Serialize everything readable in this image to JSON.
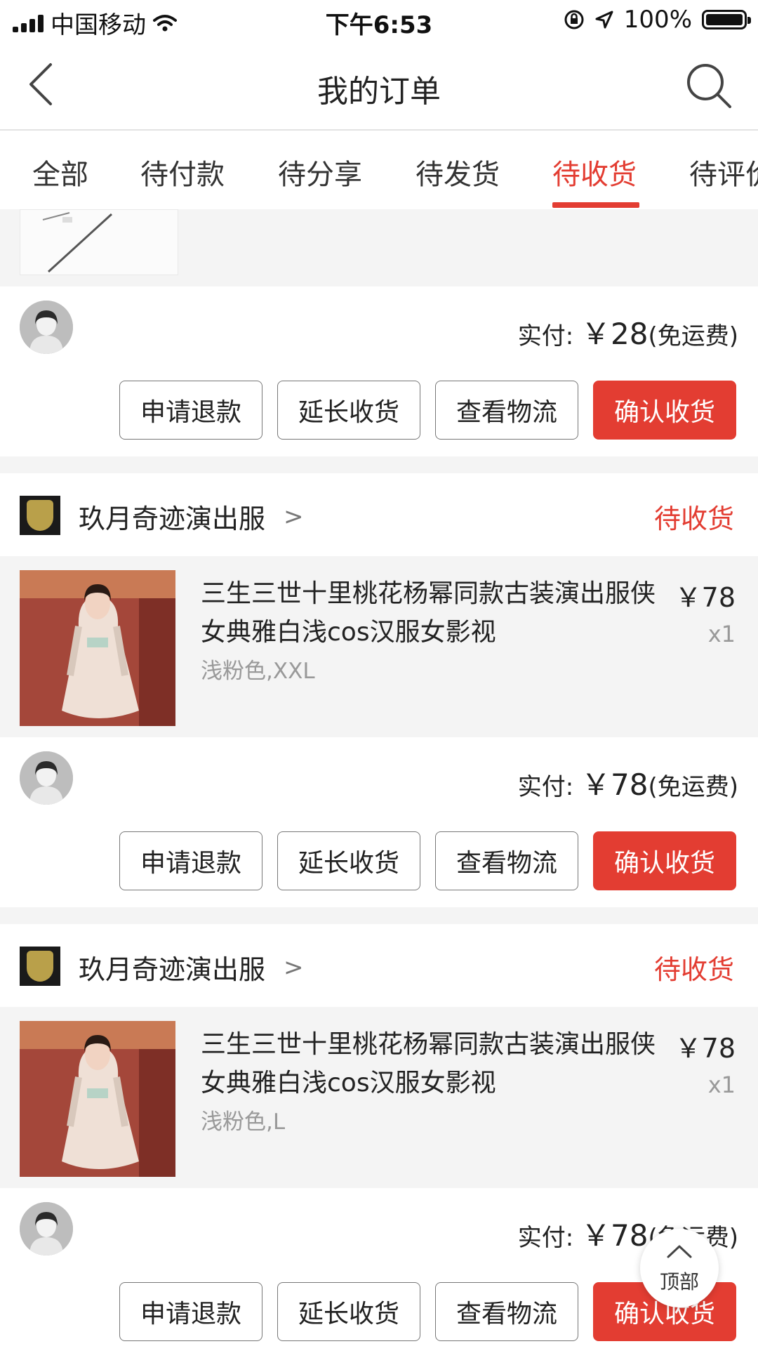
{
  "status_bar": {
    "carrier": "中国移动",
    "time": "下午6:53",
    "battery": "100%"
  },
  "nav": {
    "title": "我的订单",
    "back_icon": "chevron-left-icon",
    "search_icon": "search-icon"
  },
  "tabs": [
    {
      "label": "全部"
    },
    {
      "label": "待付款"
    },
    {
      "label": "待分享"
    },
    {
      "label": "待发货"
    },
    {
      "label": "待收货",
      "active": true
    },
    {
      "label": "待评价"
    }
  ],
  "orders": [
    {
      "summary": {
        "label": "实付:",
        "amount": "￥28",
        "note": "(免运费)"
      },
      "actions": [
        "申请退款",
        "延长收货",
        "查看物流",
        "确认收货"
      ]
    },
    {
      "shop": "玖月奇迹演出服",
      "status": "待收货",
      "item": {
        "title": "三生三世十里桃花杨幂同款古装演出服侠女典雅白浅cos汉服女影视",
        "sku": "浅粉色,XXL",
        "price": "￥78",
        "qty": "x1"
      },
      "summary": {
        "label": "实付:",
        "amount": "￥78",
        "note": "(免运费)"
      },
      "actions": [
        "申请退款",
        "延长收货",
        "查看物流",
        "确认收货"
      ]
    },
    {
      "shop": "玖月奇迹演出服",
      "status": "待收货",
      "item": {
        "title": "三生三世十里桃花杨幂同款古装演出服侠女典雅白浅cos汉服女影视",
        "sku": "浅粉色,L",
        "price": "￥78",
        "qty": "x1"
      },
      "summary": {
        "label": "实付:",
        "amount": "￥78",
        "note": "(免运费)"
      },
      "actions": [
        "申请退款",
        "延长收货",
        "查看物流",
        "确认收货"
      ]
    }
  ],
  "back_to_top": {
    "label": "顶部"
  },
  "colors": {
    "accent": "#e33d32",
    "background": "#f4f4f4"
  }
}
